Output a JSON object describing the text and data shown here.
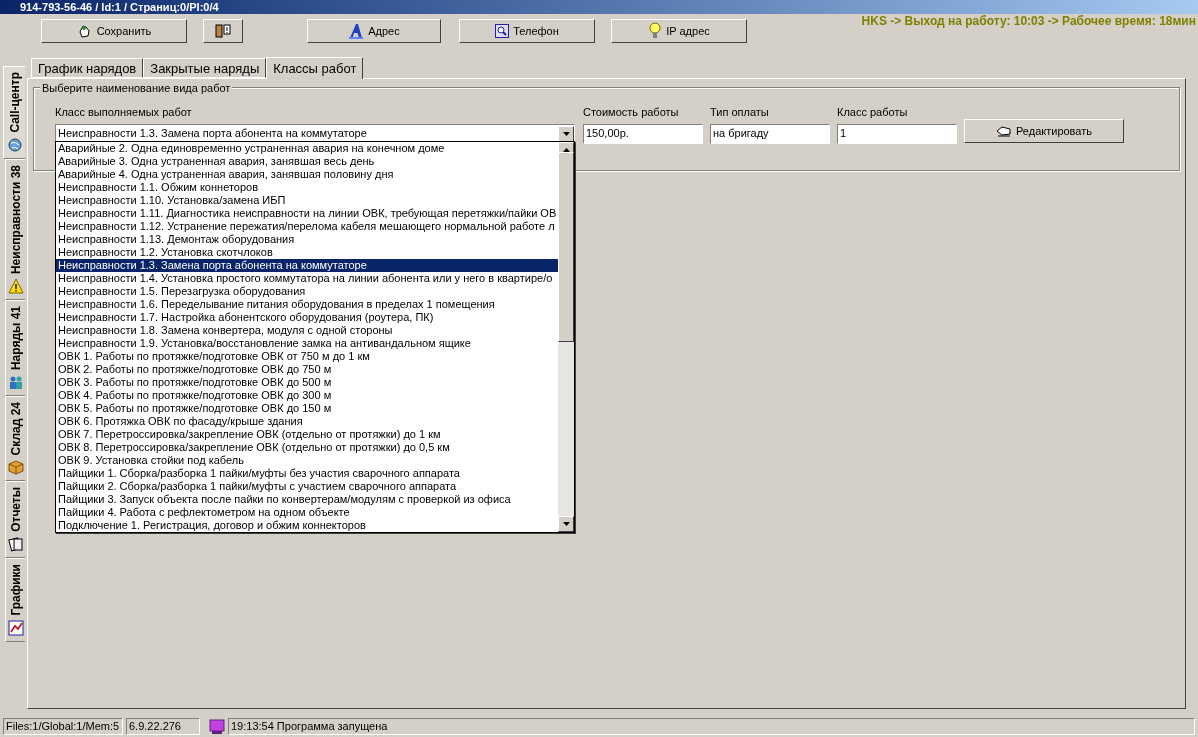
{
  "window": {
    "title": "914-793-56-46 / Id:1 / Страниц:0/PI:0/4"
  },
  "toolbar": {
    "buttons": [
      {
        "kind": "labeled",
        "label": "Сохранить"
      },
      {
        "kind": "iconic"
      },
      {
        "kind": "labeled",
        "label": "Адрес"
      },
      {
        "kind": "labeled",
        "label": "Телефон"
      },
      {
        "kind": "labeled",
        "label": "IP адрес"
      }
    ],
    "status": "HKS -> Выход на работу: 10:03 -> Рабочее время: 18мин"
  },
  "side_tabs": [
    {
      "label": "Call-центр",
      "selected": true
    },
    {
      "label": "Неисправности 38",
      "selected": false
    },
    {
      "label": "Наряды 41",
      "selected": false
    },
    {
      "label": "Склад 24",
      "selected": false
    },
    {
      "label": "Отчеты",
      "selected": false
    },
    {
      "label": "Графики",
      "selected": false
    }
  ],
  "tabs": [
    {
      "label": "График нарядов",
      "selected": false
    },
    {
      "label": "Закрытые наряды",
      "selected": false
    },
    {
      "label": "Классы работ",
      "selected": true
    }
  ],
  "group": {
    "title": "Выберите наименование вида работ",
    "fields": [
      {
        "label": "Класс выполняемых работ",
        "value": "Неисправности 1.3. Замена порта абонента на коммутаторе",
        "kind": "combo"
      },
      {
        "label": "Стоимость работы",
        "value": "150,00р.",
        "kind": "text"
      },
      {
        "label": "Тип оплаты",
        "value": "на бригаду",
        "kind": "text"
      },
      {
        "label": "Класс работы",
        "value": "1",
        "kind": "text"
      }
    ],
    "edit_button": "Редактировать"
  },
  "dropdown": {
    "items": [
      {
        "label": "Аварийные 2. Одна единовременно устраненная авария на конечном доме",
        "selected": false
      },
      {
        "label": "Аварийные 3. Одна устраненная авария, занявшая весь день",
        "selected": false
      },
      {
        "label": "Аварийные 4. Одна устраненная авария, занявшая половину дня",
        "selected": false
      },
      {
        "label": "Неисправности 1.1. Обжим коннеторов",
        "selected": false
      },
      {
        "label": "Неисправности 1.10. Установка/замена ИБП",
        "selected": false
      },
      {
        "label": "Неисправности 1.11. Диагностика неисправности на линии ОВК, требующая перетяжки/пайки ОВ",
        "selected": false
      },
      {
        "label": "Неисправности 1.12. Устранение пережатия/перелома кабеля мешающего нормальной работе л",
        "selected": false
      },
      {
        "label": "Неисправности 1.13. Демонтаж оборудования",
        "selected": false
      },
      {
        "label": "Неисправности 1.2. Установка скотчлоков",
        "selected": false
      },
      {
        "label": "Неисправности 1.3. Замена порта абонента на коммутаторе",
        "selected": true
      },
      {
        "label": "Неисправности 1.4. Установка простого коммутатора на линии абонента или у него в квартире/о",
        "selected": false
      },
      {
        "label": "Неисправности 1.5. Перезагрузка оборудования",
        "selected": false
      },
      {
        "label": "Неисправности 1.6. Переделывание питания оборудования в пределах 1 помещения",
        "selected": false
      },
      {
        "label": "Неисправности 1.7. Настройка абонентского оборудования (роутера, ПК)",
        "selected": false
      },
      {
        "label": "Неисправности 1.8. Замена конвертера, модуля с одной стороны",
        "selected": false
      },
      {
        "label": "Неисправности 1.9. Установка/восстановление замка на антивандальном ящике",
        "selected": false
      },
      {
        "label": "ОВК 1. Работы по протяжке/подготовке ОВК от 750 м до 1 км",
        "selected": false
      },
      {
        "label": "ОВК 2. Работы по протяжке/подготовке ОВК до 750 м",
        "selected": false
      },
      {
        "label": "ОВК 3. Работы по протяжке/подготовке ОВК до 500 м",
        "selected": false
      },
      {
        "label": "ОВК 4. Работы по протяжке/подготовке ОВК до 300 м",
        "selected": false
      },
      {
        "label": "ОВК 5. Работы по протяжке/подготовке ОВК до 150 м",
        "selected": false
      },
      {
        "label": "ОВК 6. Протяжка ОВК по фасаду/крыше здания",
        "selected": false
      },
      {
        "label": "ОВК 7. Перетроссировка/закрепление ОВК (отдельно от протяжки) до 1 км",
        "selected": false
      },
      {
        "label": "ОВК 8. Перетроссировка/закрепление ОВК (отдельно от протяжки) до 0,5 км",
        "selected": false
      },
      {
        "label": "ОВК 9. Установка стойки под кабель",
        "selected": false
      },
      {
        "label": "Пайщики 1. Сборка/разборка 1 пайки/муфты без участия сварочного аппарата",
        "selected": false
      },
      {
        "label": "Пайщики 2. Сборка/разборка 1 пайки/муфты с участием сварочного аппарата",
        "selected": false
      },
      {
        "label": "Пайщики 3. Запуск объекта после пайки по конвертерам/модулям с проверкой из офиса",
        "selected": false
      },
      {
        "label": "Пайщики 4. Работа с рефлектометром на одном объекте",
        "selected": false
      },
      {
        "label": "Подключение 1. Регистрация, договор и обжим коннекторов",
        "selected": false
      }
    ]
  },
  "status_bar": {
    "panels": [
      "Files:1/Global:1/Mem:5",
      "6.9.22.276"
    ],
    "message": "19:13:54 Программа запущена"
  }
}
